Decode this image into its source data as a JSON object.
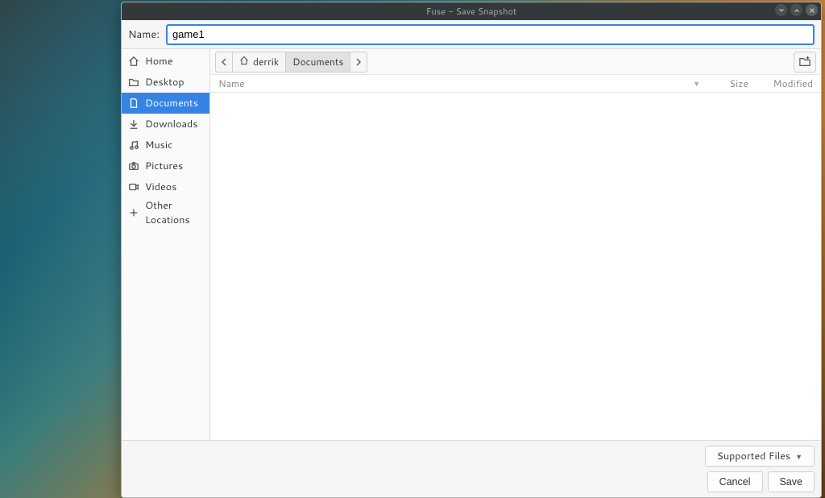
{
  "window": {
    "title": "Fuse - Save Snapshot"
  },
  "name_field": {
    "label": "Name:",
    "value": "game1"
  },
  "sidebar": {
    "items": [
      {
        "id": "home",
        "label": "Home",
        "icon": "home-icon"
      },
      {
        "id": "desktop",
        "label": "Desktop",
        "icon": "folder-icon"
      },
      {
        "id": "documents",
        "label": "Documents",
        "icon": "document-icon",
        "selected": true
      },
      {
        "id": "downloads",
        "label": "Downloads",
        "icon": "download-icon"
      },
      {
        "id": "music",
        "label": "Music",
        "icon": "music-icon"
      },
      {
        "id": "pictures",
        "label": "Pictures",
        "icon": "camera-icon"
      },
      {
        "id": "videos",
        "label": "Videos",
        "icon": "video-icon"
      }
    ],
    "other_label": "Other Locations"
  },
  "pathbar": {
    "segments": [
      {
        "label": "derrik",
        "icon": "home-icon"
      },
      {
        "label": "Documents",
        "current": true
      }
    ]
  },
  "columns": {
    "name": "Name",
    "size": "Size",
    "modified": "Modified"
  },
  "filter": {
    "label": "Supported Files"
  },
  "actions": {
    "cancel": "Cancel",
    "save": "Save"
  }
}
